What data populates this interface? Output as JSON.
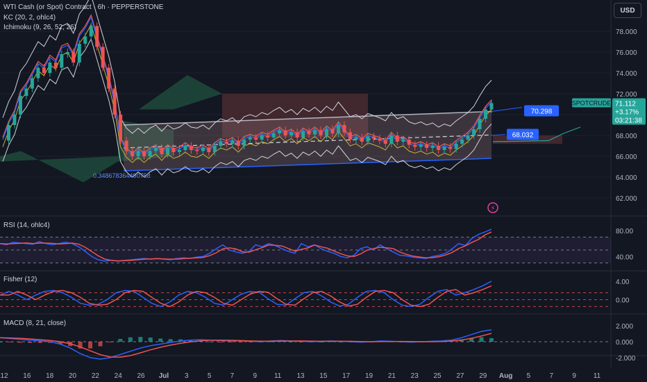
{
  "header": {
    "symbol_line": "WTI Cash (or Spot) Contract · 6h · PEPPERSTONE",
    "kc_line": "KC (20, 2, ohlc4)",
    "ichimoku_line": "Ichimoku (9, 26, 52, 26)"
  },
  "currency_button": "USD",
  "panes": {
    "rsi_label": "RSI (14, ohlc4)",
    "fisher_label": "Fisher (12)",
    "macd_label": "MACD (8, 21, close)"
  },
  "price_axis": {
    "ticks": [
      "78.000",
      "76.000",
      "74.000",
      "72.000",
      "70.000",
      "68.000",
      "66.000",
      "64.000",
      "62.000"
    ],
    "rsi_ticks": [
      "80.00",
      "40.00"
    ],
    "fisher_ticks": [
      "4.00",
      "0.00"
    ],
    "macd_ticks": [
      "2.000",
      "0.000",
      "-2.000"
    ]
  },
  "time_axis": {
    "labels": [
      "12",
      "16",
      "18",
      "20",
      "22",
      "24",
      "26",
      "Jul",
      "3",
      "5",
      "7",
      "9",
      "11",
      "13",
      "15",
      "17",
      "19",
      "21",
      "23",
      "25",
      "27",
      "29",
      "Aug",
      "5",
      "7",
      "9",
      "11"
    ]
  },
  "annotations": {
    "channel_low_value": "0.348678364490758",
    "upper_line_value": "70.298",
    "mid_line_value": "68.032",
    "instrument_label": "SPOTCRUDE",
    "last_price": "71.112",
    "change_pct": "+3.17%",
    "countdown": "03:21:38"
  },
  "colors": {
    "background": "#131722",
    "up": "#26a69a",
    "down": "#ef5350",
    "blue": "#2962ff",
    "channel_fill": "#8a6a70",
    "cloud_green": "#1e4a3c",
    "cloud_red": "#4a2a30"
  },
  "chart_data": {
    "type": "line",
    "title": "WTI Cash (or Spot) Contract · 6h · PEPPERSTONE",
    "price_ylim": [
      61,
      79
    ],
    "close": [
      67.5,
      69.0,
      70.0,
      71.8,
      72.5,
      73.5,
      74.5,
      74.0,
      75.0,
      74.5,
      75.8,
      76.0,
      75.0,
      76.8,
      77.5,
      78.5,
      76.5,
      74.5,
      72.5,
      70.0,
      67.5,
      66.5,
      66.0,
      66.5,
      66.0,
      66.5,
      66.8,
      66.2,
      66.8,
      66.4,
      66.6,
      67.0,
      66.6,
      66.5,
      66.8,
      66.4,
      67.0,
      67.4,
      67.2,
      67.5,
      67.0,
      67.6,
      67.8,
      67.6,
      68.0,
      67.8,
      68.2,
      68.5,
      68.0,
      68.3,
      67.8,
      68.4,
      68.1,
      68.5,
      68.0,
      68.6,
      68.2,
      69.0,
      68.3,
      67.6,
      67.8,
      67.4,
      67.9,
      67.7,
      67.5,
      67.2,
      68.0,
      67.4,
      67.6,
      67.1,
      66.9,
      67.1,
      66.8,
      67.0,
      66.6,
      66.9,
      66.7,
      67.2,
      67.6,
      68.0,
      68.6,
      69.6,
      70.5,
      71.1
    ],
    "rsi": [
      60,
      58,
      62,
      61,
      60,
      59,
      63,
      60,
      58,
      60,
      62,
      60,
      55,
      48,
      40,
      35,
      33,
      34,
      33,
      34,
      35,
      36,
      37,
      36,
      37,
      36,
      35,
      37,
      38,
      37,
      39,
      40,
      45,
      52,
      58,
      50,
      47,
      45,
      48,
      58,
      55,
      60,
      57,
      52,
      48,
      45,
      60,
      55,
      58,
      52,
      48,
      45,
      40,
      38,
      42,
      52,
      55,
      50,
      58,
      52,
      47,
      42,
      41,
      39,
      38,
      37,
      40,
      42,
      45,
      52,
      60,
      57,
      68,
      74,
      78,
      82
    ],
    "rsi_ylim": [
      20,
      95
    ],
    "fisher": [
      1.0,
      1.8,
      1.0,
      0.0,
      1.0,
      1.8,
      2.0,
      1.5,
      0.5,
      -0.8,
      -1.2,
      -1.0,
      0.0,
      1.5,
      2.0,
      1.8,
      0.5,
      -0.8,
      -1.5,
      -0.5,
      1.0,
      1.8,
      1.5,
      0.5,
      -0.8,
      -1.2,
      0.0,
      1.2,
      1.8,
      1.6,
      0.2,
      -1.0,
      -1.2,
      0.2,
      1.5,
      1.8,
      0.8,
      -0.5,
      -1.4,
      -1.0,
      0.5,
      1.8,
      2.0,
      1.5,
      0.0,
      -1.2,
      -1.5,
      -1.0,
      0.5,
      1.8,
      2.2,
      1.0,
      1.5,
      2.2,
      3.0,
      4.0
    ],
    "fisher_ylim": [
      -2.5,
      5.5
    ],
    "macd": [
      0.5,
      0.4,
      0.3,
      0.2,
      0.1,
      0.0,
      -0.3,
      -0.8,
      -1.5,
      -2.0,
      -2.2,
      -2.0,
      -1.6,
      -1.2,
      -0.8,
      -0.5,
      -0.3,
      -0.1,
      0.1,
      0.2,
      0.25,
      0.2,
      0.15,
      0.1,
      0.1,
      0.05,
      0.0,
      0.1,
      0.15,
      0.1,
      0.05,
      0.0,
      0.05,
      0.1,
      0.05,
      0.0,
      -0.05,
      0.0,
      0.1,
      0.05,
      0.0,
      -0.05,
      0.0,
      0.05,
      0.1,
      0.2,
      0.5,
      0.9,
      1.3,
      1.5
    ],
    "macd_ylim": [
      -2.8,
      2.8
    ],
    "levels": {
      "channel_upper_right": 70.298,
      "channel_mid_right": 68.032,
      "last": 71.112
    }
  }
}
